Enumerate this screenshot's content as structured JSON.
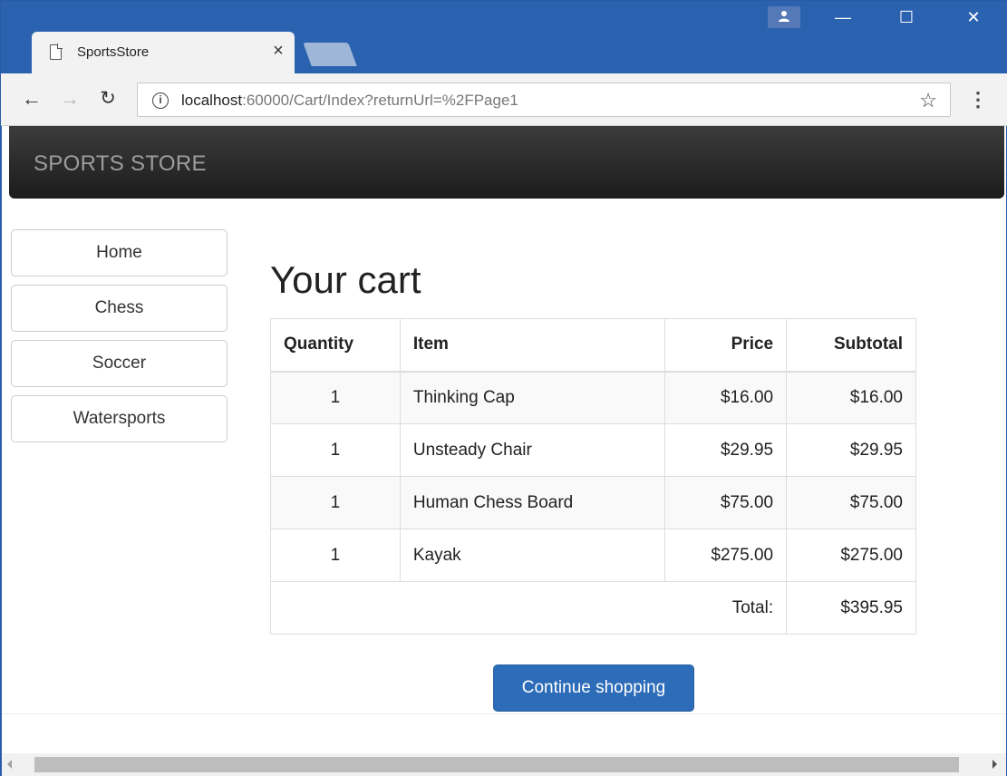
{
  "browser": {
    "tab_title": "SportsStore",
    "tab_close": "×",
    "url_host": "localhost",
    "url_rest": ":60000/Cart/Index?returnUrl=%2FPage1",
    "window_controls": {
      "minimize": "—",
      "maximize": "☐",
      "close": "✕"
    },
    "icons": [
      "page-icon",
      "back-arrow-icon",
      "forward-arrow-icon",
      "reload-icon",
      "info-icon",
      "star-icon",
      "menu-dots-icon",
      "user-icon"
    ]
  },
  "navbar": {
    "brand": "SPORTS STORE"
  },
  "sidebar": {
    "items": [
      {
        "label": "Home"
      },
      {
        "label": "Chess"
      },
      {
        "label": "Soccer"
      },
      {
        "label": "Watersports"
      }
    ]
  },
  "cart": {
    "title": "Your cart",
    "headers": {
      "quantity": "Quantity",
      "item": "Item",
      "price": "Price",
      "subtotal": "Subtotal"
    },
    "rows": [
      {
        "quantity": "1",
        "item": "Thinking Cap",
        "price": "$16.00",
        "subtotal": "$16.00"
      },
      {
        "quantity": "1",
        "item": "Unsteady Chair",
        "price": "$29.95",
        "subtotal": "$29.95"
      },
      {
        "quantity": "1",
        "item": "Human Chess Board",
        "price": "$75.00",
        "subtotal": "$75.00"
      },
      {
        "quantity": "1",
        "item": "Kayak",
        "price": "$275.00",
        "subtotal": "$275.00"
      }
    ],
    "total_label": "Total:",
    "total_value": "$395.95",
    "continue_label": "Continue shopping"
  },
  "colors": {
    "chrome_blue": "#2b62b0",
    "navbar_dark": "#222222",
    "brand_text": "#9d9d9d",
    "primary_button": "#2d6cb8"
  }
}
